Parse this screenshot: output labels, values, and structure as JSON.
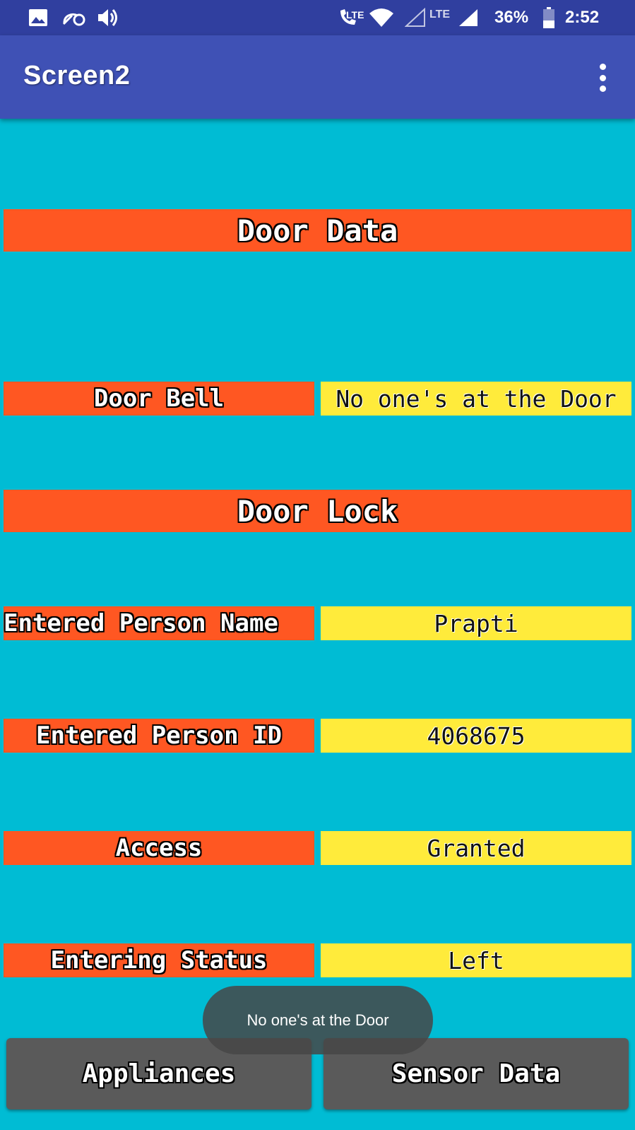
{
  "status_bar": {
    "lte_label": "LTE",
    "lte_label_2": "LTE",
    "battery": "36%",
    "time": "2:52",
    "icons": [
      "image-icon",
      "data-saver-icon",
      "volume-icon",
      "volte-call-icon",
      "wifi-icon",
      "signal-empty-icon",
      "signal-icon",
      "battery-icon"
    ]
  },
  "app_bar": {
    "title": "Screen2",
    "overflow_icon": "more-vert-icon"
  },
  "door_data": {
    "header": "Door Data",
    "door_bell_label": "Door Bell",
    "door_bell_value": "No one's at the Door"
  },
  "door_lock": {
    "header": "Door Lock",
    "rows": [
      {
        "label": "Entered Person Name",
        "value": "Prapti"
      },
      {
        "label": "Entered Person ID",
        "value": "4068675"
      },
      {
        "label": "Access",
        "value": "Granted"
      },
      {
        "label": "Entering Status",
        "value": "Left"
      }
    ]
  },
  "buttons": {
    "appliances": "Appliances",
    "sensor_data": "Sensor Data"
  },
  "toast": {
    "message": "No one's at the Door"
  },
  "colors": {
    "background": "#00BCD4",
    "status_bar": "#303F9F",
    "app_bar": "#3F51B5",
    "label_bg": "#FF5722",
    "value_bg": "#FFEB3B",
    "button_bg": "#5A5A5A"
  }
}
